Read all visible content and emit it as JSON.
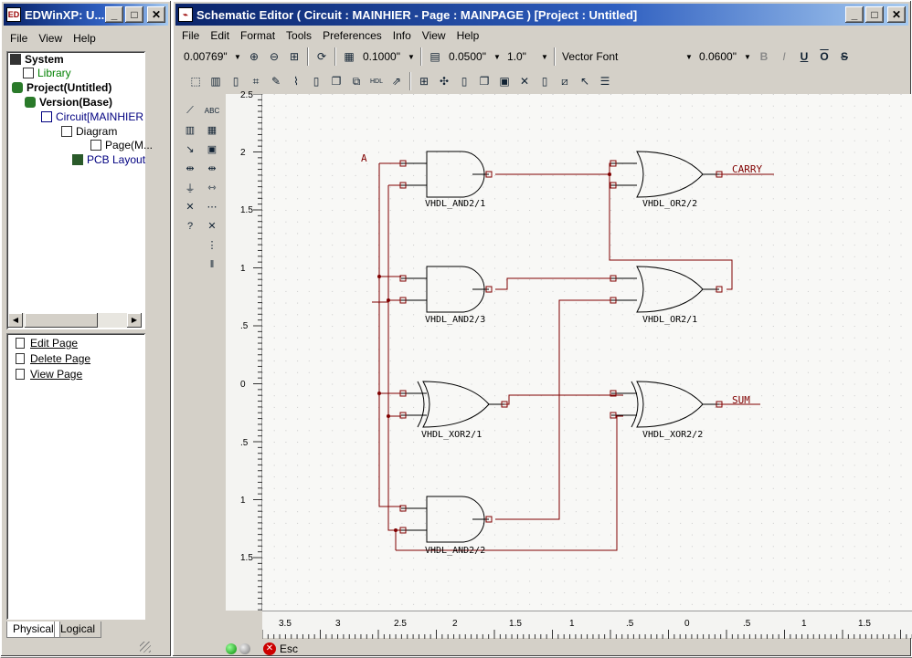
{
  "left_window": {
    "title": "EDWinXP: U...",
    "menu": [
      "File",
      "View",
      "Help"
    ],
    "tree": [
      {
        "label": "System",
        "bold": true
      },
      {
        "label": "Library",
        "color": "#008000"
      },
      {
        "label": "Project(Untitled)",
        "bold": true
      },
      {
        "label": "Version(Base)",
        "bold": true
      },
      {
        "label": "Circuit[MAINHIER",
        "color": "#000080"
      },
      {
        "label": "Diagram"
      },
      {
        "label": "Page(M..."
      },
      {
        "label": "PCB Layout",
        "color": "#000080"
      }
    ],
    "page_actions": [
      "Edit Page",
      "Delete Page",
      "View Page"
    ],
    "tabs": [
      "Physical",
      "Logical"
    ]
  },
  "editor": {
    "title": "Schematic Editor ( Circuit : MAINHIER - Page : MAINPAGE ) [Project : Untitled]",
    "menu": [
      "File",
      "Edit",
      "Format",
      "Tools",
      "Preferences",
      "Info",
      "View",
      "Help"
    ],
    "zoom_value": "0.00769\"",
    "grid_value": "0.1000\"",
    "snap_value": "0.0500\"",
    "angle_value": "1.0\"",
    "font_value": "Vector Font",
    "font_size_value": "0.0600\"",
    "format_buttons": [
      "B",
      "I",
      "U",
      "O",
      "S"
    ]
  },
  "schematic": {
    "net_labels": [
      "A",
      "CARRY",
      "SUM"
    ],
    "gates": [
      "VHDL_AND2/1",
      "VHDL_OR2/2",
      "VHDL_AND2/3",
      "VHDL_OR2/1",
      "VHDL_XOR2/1",
      "VHDL_XOR2/2",
      "VHDL_AND2/2"
    ],
    "wire_color": "#800000",
    "pin_color": "#800000"
  },
  "ruler": {
    "left_ticks": [
      "2.5",
      "2",
      "1.5",
      "1",
      ".5",
      "0",
      ".5",
      "1",
      "1.5"
    ],
    "bottom_ticks": [
      "3.5",
      "3",
      "2.5",
      "2",
      "1.5",
      "1",
      ".5",
      "0",
      ".5",
      "1",
      "1.5"
    ]
  },
  "status": {
    "esc_label": "Esc"
  }
}
